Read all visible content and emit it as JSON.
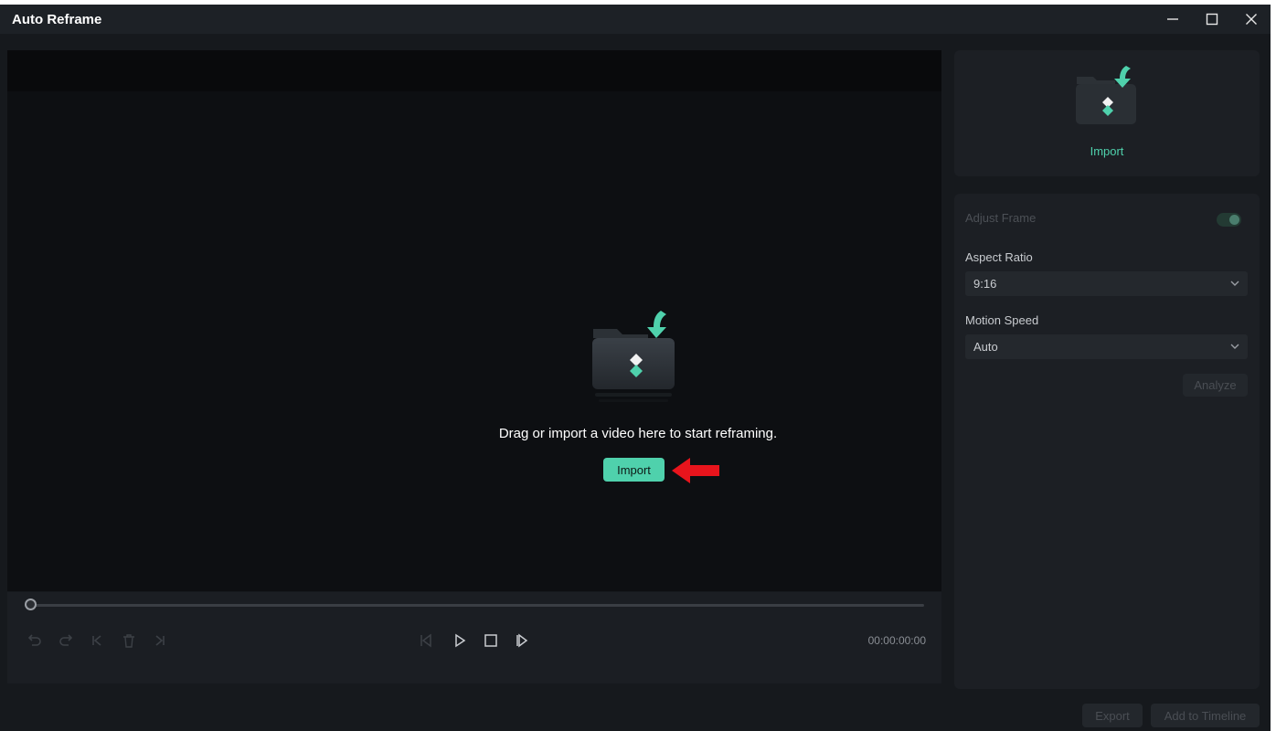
{
  "window": {
    "title": "Auto Reframe",
    "controls": {
      "minimize": "minimize-icon",
      "maximize": "maximize-icon",
      "close": "close-icon"
    }
  },
  "preview": {
    "empty_message": "Drag or import a video here to start reframing.",
    "import_label": "Import",
    "timecode": "00:00:00:00",
    "playhead_progress": 0
  },
  "transport": {
    "left_icons": [
      "undo-icon",
      "redo-icon",
      "skip-to-start-icon",
      "delete-icon",
      "skip-to-end-icon"
    ],
    "center_icons": [
      "previous-frame-icon",
      "play-icon",
      "stop-icon",
      "next-frame-icon"
    ]
  },
  "panel": {
    "import_label": "Import",
    "adjust_frame_label": "Adjust Frame",
    "adjust_frame_on": true,
    "aspect_ratio_label": "Aspect Ratio",
    "aspect_ratio_value": "9:16",
    "motion_speed_label": "Motion Speed",
    "motion_speed_value": "Auto",
    "analyze_label": "Analyze"
  },
  "footer": {
    "export_label": "Export",
    "add_to_timeline_label": "Add to Timeline"
  },
  "colors": {
    "accent": "#4fd1ac",
    "background": "#16191d",
    "preview": "#0d0f12",
    "annotation_arrow": "#e8141c"
  }
}
